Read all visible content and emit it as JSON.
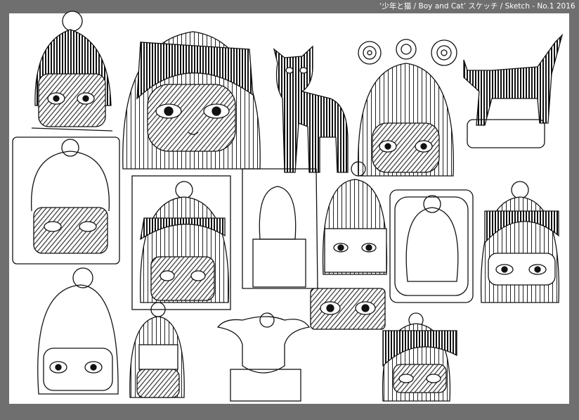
{
  "header": {
    "caption": "‘少年と猫 / Boy and Cat’  スケッチ / Sketch - No.1   2016"
  },
  "artwork": {
    "type": "pen-and-ink sketch sheet",
    "ink_color": "#111111",
    "paper_color": "#ffffff",
    "frame_color": "#6f6f6f"
  }
}
